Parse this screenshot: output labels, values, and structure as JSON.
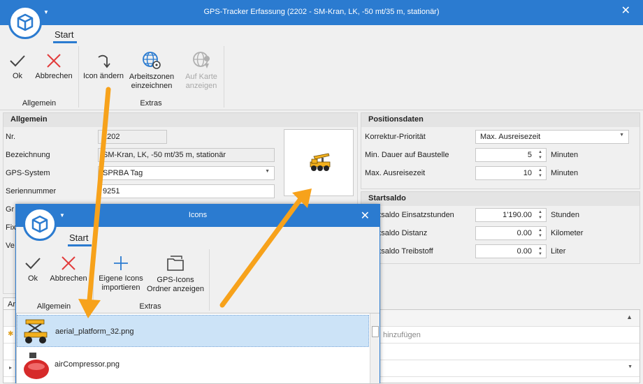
{
  "main": {
    "window_title": "GPS-Tracker Erfassung (2202 - SM-Kran, LK, -50 mt/35 m, stationär)",
    "tab": "Start",
    "ribbon": {
      "ok": "Ok",
      "cancel": "Abbrechen",
      "change_icon": "Icon ändern",
      "draw_zones_line1": "Arbeitszonen",
      "draw_zones_line2": "einzeichnen",
      "show_map_line1": "Auf Karte",
      "show_map_line2": "anzeigen",
      "group_general": "Allgemein",
      "group_extras": "Extras"
    },
    "general": {
      "header": "Allgemein",
      "nr_label": "Nr.",
      "nr_value": "2202",
      "name_label": "Bezeichnung",
      "name_value": "SM-Kran, LK, -50 mt/35 m, stationär",
      "gps_label": "GPS-System",
      "gps_value": "SPRBA Tag",
      "serial_label": "Seriennummer",
      "serial_value": "9251",
      "row5_label": "Gr",
      "row6_label": "Fix",
      "row7_label": "Ve"
    },
    "position": {
      "header": "Positionsdaten",
      "priority_label": "Korrektur-Priorität",
      "priority_value": "Max. Ausreisezeit",
      "min_stay_label": "Min. Dauer auf Baustelle",
      "min_stay_value": "5",
      "min_stay_unit": "Minuten",
      "max_out_label": "Max. Ausreisezeit",
      "max_out_value": "10",
      "max_out_unit": "Minuten"
    },
    "start_balance": {
      "header": "Startsaldo",
      "hours_label": "Startsaldo Einsatzstunden",
      "hours_value": "1'190.00",
      "hours_unit": "Stunden",
      "dist_label": "Startsaldo Distanz",
      "dist_value": "0.00",
      "dist_unit": "Kilometer",
      "fuel_label": "Startsaldo Treibstoff",
      "fuel_value": "0.00",
      "fuel_unit": "Liter"
    },
    "bottom": {
      "tab_label": "Ar",
      "add_placeholder": "hinzufügen"
    }
  },
  "dialog": {
    "title": "Icons",
    "tab": "Start",
    "ribbon": {
      "ok": "Ok",
      "cancel": "Abbrechen",
      "import_line1": "Eigene Icons",
      "import_line2": "importieren",
      "folder_line1": "GPS-Icons",
      "folder_line2": "Ordner anzeigen",
      "group_general": "Allgemein",
      "group_extras": "Extras"
    },
    "icons": [
      {
        "file": "aerial_platform_32.png",
        "selected": true
      },
      {
        "file": "airCompressor.png",
        "selected": false
      }
    ]
  },
  "colors": {
    "accent": "#2b7bd0",
    "arrow": "#f7a21b",
    "cancel_red": "#e23b3b"
  }
}
